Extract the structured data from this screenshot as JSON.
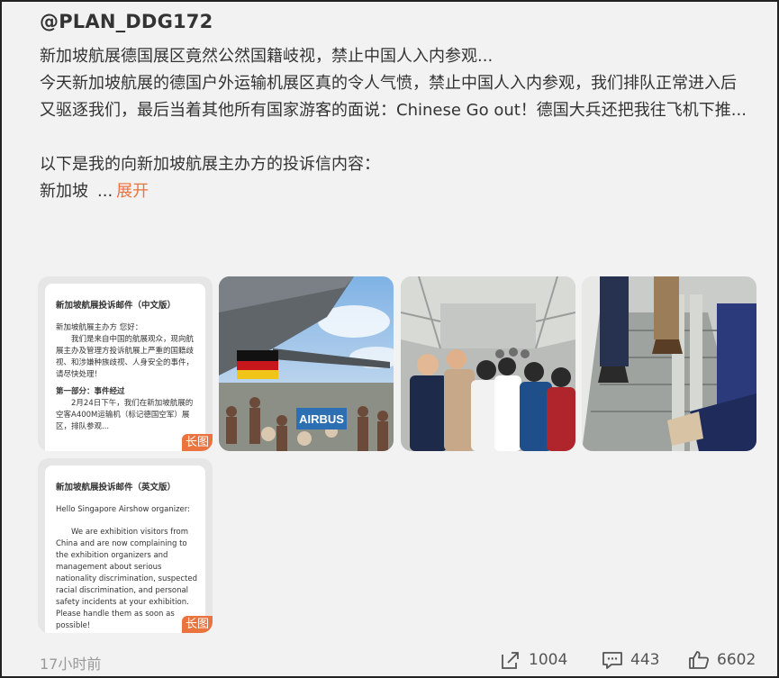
{
  "post": {
    "author": "@PLAN_DDG172",
    "line1": "新加坡航展德国展区竟然公然国籍岐视，禁止中国人入内参观...",
    "para1": "今天新加坡航展的德国户外运输机展区真的令人气愤，禁止中国人入内参观，我们排队正常进入后又驱逐我们，最后当着其他所有国家游客的面说：Chinese Go out！德国大兵还把我往飞机下推...",
    "line3": "以下是我的向新加坡航展主办方的投诉信内容：",
    "line4": "新加坡",
    "ellipsis": "...",
    "more_label": "展开"
  },
  "images": {
    "long_badge": "长图",
    "doc_cn": {
      "title": "新加坡航展投诉邮件（中文版）",
      "greeting": "新加坡航展主办方 您好：",
      "body": "我们是来自中国的航展观众，现向航展主办及管理方投诉航展上严重的国籍歧视、和涉嫌种族歧视、人身安全的事件，请尽快处理！",
      "section": "第一部分：事件经过",
      "section_body": "2月24日下午，我们在新加坡航展的空客A400M运输机（标记德国空军）展区，排队参观..."
    },
    "doc_en": {
      "title": "新加坡航展投诉邮件（英文版）",
      "greeting": "Hello Singapore Airshow organizer:",
      "body": "We are exhibition visitors from China and are now complaining to the exhibition organizers and management about serious nationality discrimination, suspected racial discrimination, and personal safety incidents at your exhibition. Please handle them as soon as possible!"
    },
    "photo1_text": "AIRBUS"
  },
  "footer": {
    "time": "17小时前",
    "shares": "1004",
    "comments": "443",
    "likes": "6602"
  },
  "colors": {
    "accent": "#eb7340",
    "text": "#333333",
    "muted": "#999999"
  }
}
